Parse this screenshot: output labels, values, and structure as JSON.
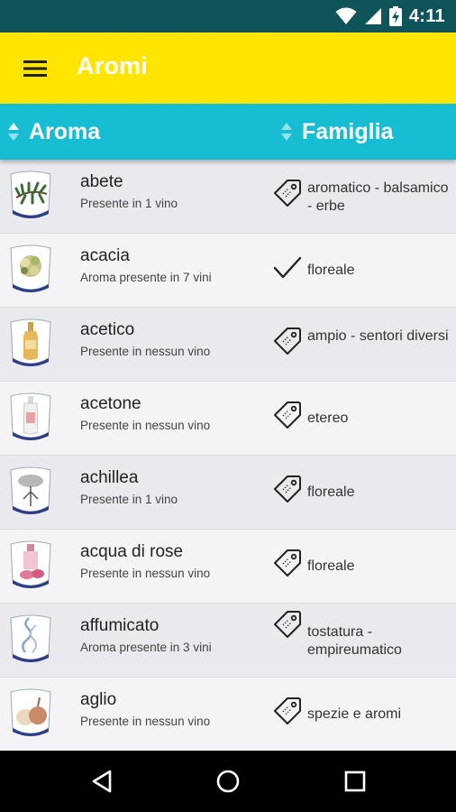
{
  "status_bar": {
    "time": "4:11"
  },
  "app_bar": {
    "title": "Aromi"
  },
  "header": {
    "col_aroma": "Aroma",
    "col_famiglia": "Famiglia"
  },
  "colors": {
    "status": "#0f5459",
    "app_bar": "#ffe500",
    "header": "#16bdd3"
  },
  "rows": [
    {
      "name": "abete",
      "count": "Presente in 1 vino",
      "family": "aromatico - balsamico - erbe",
      "icon": "tag-icon",
      "thumb": "fir-branch"
    },
    {
      "name": "acacia",
      "count": "Aroma presente in 7 vini",
      "family": "floreale",
      "icon": "check-icon",
      "thumb": "acacia-flower"
    },
    {
      "name": "acetico",
      "count": "Presente in nessun vino",
      "family": "ampio - sentori diversi",
      "icon": "tag-icon",
      "thumb": "vinegar-bottle"
    },
    {
      "name": "acetone",
      "count": "Presente in nessun vino",
      "family": "etereo",
      "icon": "tag-icon",
      "thumb": "acetone-bottle"
    },
    {
      "name": "achillea",
      "count": "Presente in 1 vino",
      "family": "floreale",
      "icon": "tag-icon",
      "thumb": "achillea-plant"
    },
    {
      "name": "acqua di rose",
      "count": "Presente in nessun vino",
      "family": "floreale",
      "icon": "tag-icon",
      "thumb": "rose-water"
    },
    {
      "name": "affumicato",
      "count": "Aroma presente in 3 vini",
      "family": "tostatura - empireumatico",
      "icon": "tag-icon",
      "thumb": "smoke"
    },
    {
      "name": "aglio",
      "count": "Presente in nessun vino",
      "family": "spezie e aromi",
      "icon": "tag-icon",
      "thumb": "garlic"
    }
  ]
}
